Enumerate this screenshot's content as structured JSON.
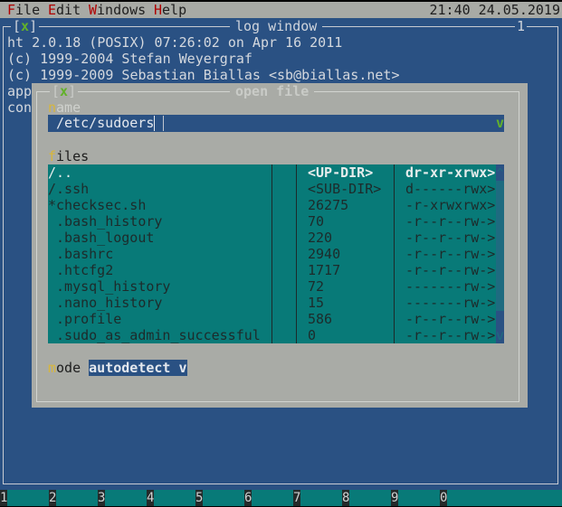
{
  "menubar": {
    "items": [
      {
        "hot": "F",
        "rest": "ile"
      },
      {
        "hot": "E",
        "rest": "dit"
      },
      {
        "hot": "W",
        "rest": "indows"
      },
      {
        "hot": "H",
        "rest": "elp"
      }
    ],
    "clock": "21:40 24.05.2019"
  },
  "log_window": {
    "close": "x",
    "title": "log window",
    "number": "1",
    "lines": [
      "ht 2.0.18 (POSIX) 07:26:02 on Apr 16 2011",
      "(c) 1999-2004 Stefan Weyergraf",
      "(c) 1999-2009 Sebastian Biallas <sb@biallas.net>",
      "app",
      "con"
    ]
  },
  "dialog": {
    "close": "x",
    "title": "open file",
    "name_label": {
      "hot": "n",
      "rest": "ame"
    },
    "name_value": "/etc/sudoers",
    "dropdown": "v",
    "files_label": {
      "hot": "f",
      "rest": "iles"
    },
    "files": [
      {
        "name": "/..",
        "size": "<UP-DIR>",
        "perm": "dr-xr-xrwx>"
      },
      {
        "name": "/.ssh",
        "size": "<SUB-DIR>",
        "perm": "d------rwx>"
      },
      {
        "name": "*checksec.sh",
        "size": "26275",
        "perm": "-r-xrwxrwx>"
      },
      {
        "name": " .bash_history",
        "size": "70",
        "perm": "-r--r--rw->"
      },
      {
        "name": " .bash_logout",
        "size": "220",
        "perm": "-r--r--rw->"
      },
      {
        "name": " .bashrc",
        "size": "2940",
        "perm": "-r--r--rw->"
      },
      {
        "name": " .htcfg2",
        "size": "1717",
        "perm": "-r--r--rw->"
      },
      {
        "name": " .mysql_history",
        "size": "72",
        "perm": "-------rw->"
      },
      {
        "name": " .nano_history",
        "size": "15",
        "perm": "-------rw->"
      },
      {
        "name": " .profile",
        "size": "586",
        "perm": "-r--r--rw->"
      },
      {
        "name": " .sudo_as_admin_successful",
        "size": "0",
        "perm": "-r--r--rw->"
      }
    ],
    "scroll_up": "^",
    "scroll_down": "v",
    "mode_label": {
      "hot": "m",
      "rest": "ode"
    },
    "mode_value": "autodetect v"
  },
  "fkeys": [
    "1",
    "2",
    "3",
    "4",
    "5",
    "6",
    "7",
    "8",
    "9",
    "0"
  ]
}
